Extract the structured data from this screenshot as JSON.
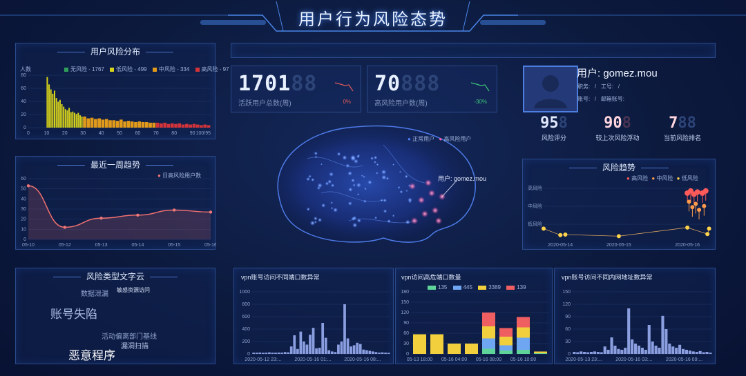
{
  "header": {
    "title": "用户行为风险态势"
  },
  "risk_distribution": {
    "title": "用户风险分布",
    "ylabel": "人数",
    "legend": [
      "无风险 - 1767",
      "低风险 - 499",
      "中风险 - 334",
      "高风险 - 97"
    ],
    "colors": [
      "#2fa05a",
      "#d6d21a",
      "#e29a1b",
      "#d2343a"
    ],
    "yticks": [
      "80",
      "60",
      "40",
      "20",
      "0"
    ],
    "xticks": [
      "0",
      "10",
      "20",
      "30",
      "40",
      "50",
      "60",
      "70",
      "80",
      "90",
      "100/95"
    ]
  },
  "weekly_trend": {
    "title": "最近一周趋势",
    "legend": "日高风险用户数",
    "yticks": [
      "60",
      "50",
      "40",
      "30",
      "20",
      "10",
      "0"
    ],
    "xticks": [
      "05-10",
      "05-12",
      "05-13",
      "05-14",
      "05-15",
      "05-16"
    ]
  },
  "word_cloud": {
    "title": "风险类型文字云",
    "words": [
      "数据泄漏",
      "敏感资源访问",
      "账号失陷",
      "活动偏离部门基线",
      "漏洞扫描",
      "恶意程序"
    ]
  },
  "kpis": {
    "active_users": {
      "value": "1701",
      "ghost": "88",
      "label": "活跃用户总数(周)",
      "pct": "0%"
    },
    "high_risk": {
      "value": "70",
      "ghost": "888",
      "label": "高风险用户数(周)",
      "pct": "-30%"
    }
  },
  "brain": {
    "legend": [
      "正常用户",
      "高风险用户"
    ],
    "callout": "用户: gomez.mou"
  },
  "user": {
    "name_label": "用户:",
    "name": "gomez.mou",
    "line1_a": "职务:",
    "line1_b": "/",
    "line1_c": "工号:",
    "line1_d": "/",
    "line2_a": "账号:",
    "line2_b": "/",
    "line2_c": "邮箱账号:",
    "score": {
      "value": "95",
      "ghost": "8",
      "label": "风险评分"
    },
    "change": {
      "value": "90",
      "ghost": "8",
      "label": "较上次风险浮动"
    },
    "rank": {
      "value": "7",
      "ghost": "88",
      "label": "当前风险排名"
    }
  },
  "risk_trend": {
    "title": "风险趋势",
    "legend": [
      "高风险",
      "中风险",
      "低风险"
    ],
    "yticks": [
      "高风险",
      "中风险",
      "低风险"
    ],
    "xticks": [
      "2020-05-14",
      "2020-05-15",
      "2020-05-16"
    ]
  },
  "vpn_ports": {
    "title": "vpn账号访问不同端口数异常",
    "yticks": [
      "1000",
      "800",
      "600",
      "400",
      "200",
      "0"
    ],
    "xticks": [
      "2020-05-12 23:...",
      "2020-05-16 01:...",
      "2020-05-16 08:..."
    ]
  },
  "vpn_high_risk": {
    "title": "vpn访问高危端口数量",
    "legend": [
      "135",
      "445",
      "3389",
      "139"
    ],
    "yticks": [
      "180",
      "150",
      "120",
      "90",
      "60",
      "30",
      "0"
    ],
    "xticks": [
      "05-13 18:00",
      "05-16 04:00",
      "05-16 08:00",
      "05-16 10:00"
    ]
  },
  "vpn_intranet": {
    "title": "vpn账号访问不同内网地址数异常",
    "yticks": [
      "150",
      "120",
      "90",
      "60",
      "30",
      "0"
    ],
    "xticks": [
      "2020-05-13 23:...",
      "2020-05-16 03:...",
      "2020-05-16 09:..."
    ]
  },
  "chart_data": [
    {
      "type": "bar",
      "title": "用户风险分布",
      "ylabel": "人数",
      "xlim": [
        0,
        100
      ],
      "ylim": [
        0,
        85
      ],
      "series": [
        {
          "name": "低风险",
          "x": [
            10,
            11,
            12,
            13,
            14,
            15,
            16,
            17,
            18,
            19,
            20,
            21,
            22,
            23,
            24,
            25,
            26,
            27,
            28,
            29
          ],
          "values": [
            82,
            70,
            62,
            55,
            60,
            48,
            42,
            45,
            38,
            34,
            30,
            28,
            32,
            25,
            26,
            24,
            22,
            24,
            20,
            18
          ]
        },
        {
          "name": "中风险",
          "x": [
            30,
            32,
            34,
            36,
            38,
            40,
            42,
            44,
            46,
            48,
            50,
            52,
            54,
            56,
            58,
            60,
            62,
            64,
            66,
            68
          ],
          "values": [
            18,
            15,
            16,
            14,
            15,
            13,
            14,
            12,
            12,
            11,
            13,
            10,
            11,
            10,
            9,
            10,
            9,
            9,
            8,
            8
          ]
        },
        {
          "name": "高风险",
          "x": [
            70,
            72,
            74,
            76,
            78,
            80,
            82,
            84,
            86,
            88,
            90,
            92,
            94,
            96,
            98
          ],
          "values": [
            8,
            7,
            8,
            6,
            7,
            6,
            7,
            5,
            6,
            5,
            6,
            5,
            4,
            5,
            4
          ]
        }
      ]
    },
    {
      "type": "area",
      "title": "最近一周趋势",
      "categories": [
        "05-10",
        "05-12",
        "05-13",
        "05-14",
        "05-15",
        "05-16"
      ],
      "series": [
        {
          "name": "日高风险用户数",
          "values": [
            53,
            12,
            21,
            24,
            29,
            27
          ]
        }
      ],
      "ylim": [
        0,
        60
      ]
    },
    {
      "type": "scatter",
      "title": "风险趋势",
      "series": [
        {
          "name": "高风险",
          "points": [
            [
              0.86,
              0.86
            ],
            [
              0.88,
              0.9
            ],
            [
              0.9,
              0.84
            ],
            [
              0.92,
              0.88
            ],
            [
              0.95,
              0.86
            ],
            [
              0.97,
              0.9
            ]
          ]
        },
        {
          "name": "中风险",
          "points": [
            [
              0.87,
              0.7
            ],
            [
              0.89,
              0.6
            ],
            [
              0.91,
              0.66
            ],
            [
              0.93,
              0.55
            ],
            [
              0.96,
              0.62
            ]
          ]
        },
        {
          "name": "低风险",
          "points": [
            [
              0.0,
              0.2
            ],
            [
              0.1,
              0.08
            ],
            [
              0.13,
              0.09
            ],
            [
              0.45,
              0.06
            ],
            [
              0.86,
              0.22
            ],
            [
              0.98,
              0.1
            ],
            [
              0.99,
              0.2
            ]
          ]
        }
      ]
    },
    {
      "type": "bar",
      "title": "vpn账号访问不同端口数异常",
      "ylim": [
        0,
        1000
      ],
      "values": [
        20,
        20,
        22,
        18,
        20,
        25,
        20,
        20,
        22,
        20,
        30,
        25,
        120,
        300,
        80,
        360,
        200,
        150,
        310,
        420,
        90,
        100,
        500,
        260,
        60,
        40,
        30,
        150,
        200,
        800,
        250,
        120,
        140,
        180,
        160,
        70,
        60,
        50,
        40,
        30,
        20,
        25,
        20,
        18
      ]
    },
    {
      "type": "bar",
      "title": "vpn访问高危端口数量",
      "categories": [
        "05-13 18:00",
        "",
        "05-16 04:00",
        "",
        "05-16 08:00",
        "",
        "05-16 10:00",
        ""
      ],
      "series": [
        {
          "name": "135",
          "values": [
            0,
            0,
            0,
            0,
            15,
            10,
            12,
            2
          ]
        },
        {
          "name": "445",
          "values": [
            0,
            0,
            0,
            0,
            30,
            15,
            35,
            0
          ]
        },
        {
          "name": "3389",
          "values": [
            57,
            57,
            30,
            30,
            35,
            25,
            30,
            5
          ]
        },
        {
          "name": "139",
          "values": [
            0,
            0,
            0,
            0,
            40,
            25,
            30,
            0
          ]
        }
      ],
      "ylim": [
        0,
        180
      ]
    },
    {
      "type": "bar",
      "title": "vpn账号访问不同内网地址数异常",
      "ylim": [
        0,
        150
      ],
      "values": [
        5,
        4,
        6,
        5,
        4,
        5,
        6,
        5,
        4,
        18,
        10,
        40,
        20,
        12,
        10,
        15,
        110,
        35,
        25,
        20,
        15,
        10,
        70,
        30,
        20,
        15,
        92,
        60,
        25,
        18,
        15,
        22,
        12,
        10,
        8,
        6,
        5,
        7,
        4,
        5,
        3
      ]
    }
  ]
}
